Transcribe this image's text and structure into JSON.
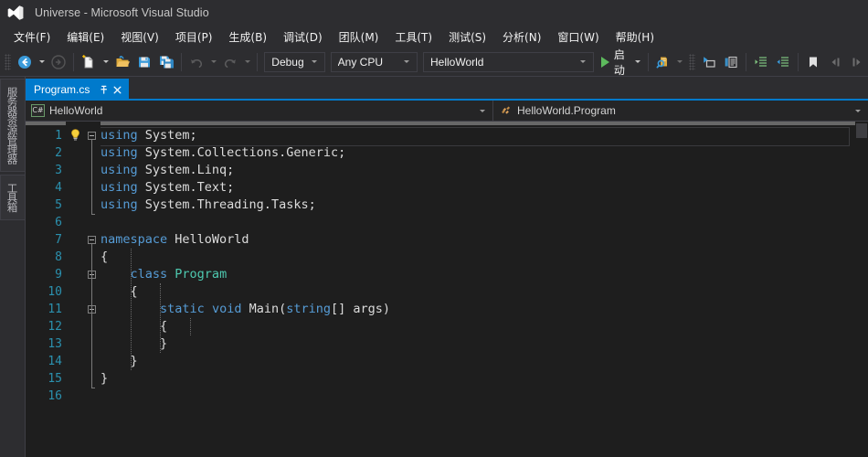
{
  "window": {
    "title": "Universe - Microsoft Visual Studio",
    "logo_icon": "visual-studio-logo-icon"
  },
  "menubar": {
    "items": [
      {
        "label": "文件(F)"
      },
      {
        "label": "编辑(E)"
      },
      {
        "label": "视图(V)"
      },
      {
        "label": "项目(P)"
      },
      {
        "label": "生成(B)"
      },
      {
        "label": "调试(D)"
      },
      {
        "label": "团队(M)"
      },
      {
        "label": "工具(T)"
      },
      {
        "label": "测试(S)"
      },
      {
        "label": "分析(N)"
      },
      {
        "label": "窗口(W)"
      },
      {
        "label": "帮助(H)"
      }
    ]
  },
  "toolbar": {
    "navigate_back_icon": "navigate-back-icon",
    "navigate_forward_icon": "navigate-forward-icon",
    "new_item_icon": "new-file-icon",
    "open_file_icon": "open-file-icon",
    "save_icon": "save-icon",
    "save_all_icon": "save-all-icon",
    "undo_icon": "undo-icon",
    "redo_icon": "redo-icon",
    "configuration": {
      "value": "Debug"
    },
    "platform": {
      "value": "Any CPU"
    },
    "startup_project": {
      "value": "HelloWorld"
    },
    "start_label": "启动",
    "start_icon": "play-icon",
    "find_icon": "find-in-files-icon",
    "step_icon": "step-into-icon",
    "comment_icon": "comment-selection-icon",
    "uncomment_icon": "uncomment-selection-icon",
    "indent_icon": "increase-indent-icon",
    "outdent_icon": "decrease-indent-icon",
    "bookmark_icon": "bookmark-icon",
    "prev_bookmark_icon": "previous-bookmark-icon",
    "next_bookmark_icon": "next-bookmark-icon"
  },
  "left_dock": {
    "tabs": [
      {
        "label": "服务器资源管理器",
        "name": "server-explorer"
      },
      {
        "label": "工具箱",
        "name": "toolbox"
      }
    ]
  },
  "document_tabs": [
    {
      "label": "Program.cs",
      "pin_icon": "pin-icon",
      "close_icon": "close-icon",
      "active": true
    }
  ],
  "navigation_bar": {
    "left": {
      "value": "HelloWorld",
      "icon": "csharp-project-icon"
    },
    "right": {
      "value": "HelloWorld.Program",
      "icon": "class-icon"
    }
  },
  "editor": {
    "lightbulb_icon": "lightbulb-quick-actions-icon",
    "line_numbers": [
      1,
      2,
      3,
      4,
      5,
      6,
      7,
      8,
      9,
      10,
      11,
      12,
      13,
      14,
      15,
      16
    ],
    "lines": [
      {
        "n": 1,
        "tokens": [
          {
            "t": "kw",
            "v": "using"
          },
          {
            "t": "pl",
            "v": " System;"
          }
        ],
        "highlight": true
      },
      {
        "n": 2,
        "tokens": [
          {
            "t": "kw",
            "v": "using"
          },
          {
            "t": "pl",
            "v": " System.Collections.Generic;"
          }
        ]
      },
      {
        "n": 3,
        "tokens": [
          {
            "t": "kw",
            "v": "using"
          },
          {
            "t": "pl",
            "v": " System.Linq;"
          }
        ]
      },
      {
        "n": 4,
        "tokens": [
          {
            "t": "kw",
            "v": "using"
          },
          {
            "t": "pl",
            "v": " System.Text;"
          }
        ]
      },
      {
        "n": 5,
        "tokens": [
          {
            "t": "kw",
            "v": "using"
          },
          {
            "t": "pl",
            "v": " System.Threading.Tasks;"
          }
        ]
      },
      {
        "n": 6,
        "tokens": []
      },
      {
        "n": 7,
        "tokens": [
          {
            "t": "kw",
            "v": "namespace"
          },
          {
            "t": "pl",
            "v": " HelloWorld"
          }
        ]
      },
      {
        "n": 8,
        "tokens": [
          {
            "t": "pl",
            "v": "{"
          }
        ]
      },
      {
        "n": 9,
        "tokens": [
          {
            "t": "pl",
            "v": "    "
          },
          {
            "t": "kw",
            "v": "class"
          },
          {
            "t": "pl",
            "v": " "
          },
          {
            "t": "typ",
            "v": "Program"
          }
        ]
      },
      {
        "n": 10,
        "tokens": [
          {
            "t": "pl",
            "v": "    {"
          }
        ]
      },
      {
        "n": 11,
        "tokens": [
          {
            "t": "pl",
            "v": "        "
          },
          {
            "t": "kw",
            "v": "static"
          },
          {
            "t": "pl",
            "v": " "
          },
          {
            "t": "kw",
            "v": "void"
          },
          {
            "t": "pl",
            "v": " Main("
          },
          {
            "t": "kw",
            "v": "string"
          },
          {
            "t": "pl",
            "v": "[] args)"
          }
        ]
      },
      {
        "n": 12,
        "tokens": [
          {
            "t": "pl",
            "v": "        {"
          }
        ]
      },
      {
        "n": 13,
        "tokens": [
          {
            "t": "pl",
            "v": "        }"
          }
        ]
      },
      {
        "n": 14,
        "tokens": [
          {
            "t": "pl",
            "v": "    }"
          }
        ]
      },
      {
        "n": 15,
        "tokens": [
          {
            "t": "pl",
            "v": "}"
          }
        ]
      },
      {
        "n": 16,
        "tokens": []
      }
    ],
    "fold_regions": [
      {
        "line": 1,
        "name": "usings-fold"
      },
      {
        "line": 7,
        "name": "namespace-fold"
      },
      {
        "line": 9,
        "name": "class-fold"
      },
      {
        "line": 11,
        "name": "method-fold"
      }
    ]
  },
  "colors": {
    "accent": "#007acc",
    "chrome": "#2d2d30",
    "editor_bg": "#1e1e1e",
    "keyword": "#569cd6",
    "type": "#4ec9b0",
    "line_number": "#2b91af",
    "plain_text": "#dcdcdc",
    "start_green": "#5dba5d"
  }
}
